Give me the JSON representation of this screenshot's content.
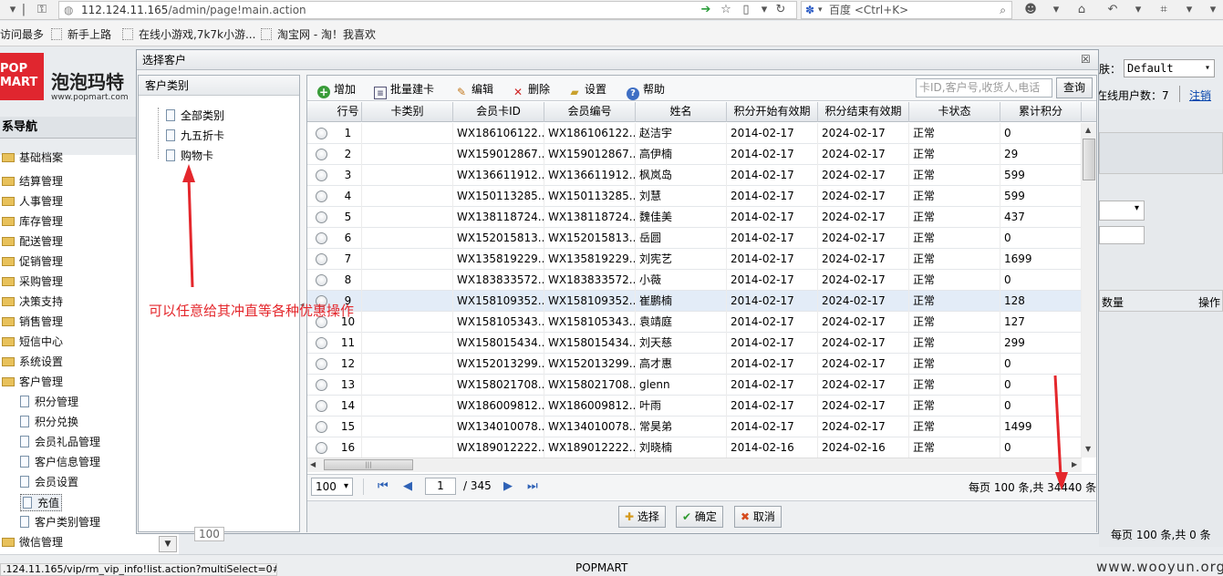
{
  "browser": {
    "url_host": "112.124.11.165",
    "url_path": "/admin/page!main.action",
    "search_engine": "百度",
    "search_placeholder": "<Ctrl+K>",
    "bookmarks": [
      "访问最多",
      "新手上路",
      "在线小游戏,7k7k小游...",
      "淘宝网 - 淘！我喜欢"
    ]
  },
  "app": {
    "logo_line1": "POP",
    "logo_line2": "MART",
    "name": "泡泡玛特",
    "site": "www.popmart.com",
    "theme_label": "肤：",
    "theme_value": "Default",
    "online_label": "在线用户数：7",
    "logout": "注销"
  },
  "sidebar": {
    "title": "系导航",
    "items": [
      {
        "label": "基础档案",
        "type": "folder"
      },
      {
        "label": "结算管理",
        "type": "folder"
      },
      {
        "label": "人事管理",
        "type": "folder"
      },
      {
        "label": "库存管理",
        "type": "folder"
      },
      {
        "label": "配送管理",
        "type": "folder"
      },
      {
        "label": "促销管理",
        "type": "folder"
      },
      {
        "label": "采购管理",
        "type": "folder"
      },
      {
        "label": "决策支持",
        "type": "folder"
      },
      {
        "label": "销售管理",
        "type": "folder"
      },
      {
        "label": "短信中心",
        "type": "folder"
      },
      {
        "label": "系统设置",
        "type": "folder"
      },
      {
        "label": "客户管理",
        "type": "folder-open"
      },
      {
        "label": "积分管理",
        "type": "doc"
      },
      {
        "label": "积分兑换",
        "type": "doc"
      },
      {
        "label": "会员礼品管理",
        "type": "doc"
      },
      {
        "label": "客户信息管理",
        "type": "doc"
      },
      {
        "label": "会员设置",
        "type": "doc"
      },
      {
        "label": "充值",
        "type": "doc"
      },
      {
        "label": "客户类别管理",
        "type": "doc"
      },
      {
        "label": "微信管理",
        "type": "folder"
      }
    ]
  },
  "background": {
    "qty_header": "数量",
    "op_header": "操作",
    "pager_text": "每页 100 条,共 0 条",
    "behind_pager": "100"
  },
  "dialog": {
    "title": "选择客户",
    "close": "☒",
    "category_header": "客户类别",
    "categories": [
      "全部类别",
      "九五折卡",
      "购物卡"
    ],
    "toolbar": {
      "add": "增加",
      "batch": "批量建卡",
      "edit": "编辑",
      "delete": "删除",
      "settings": "设置",
      "help": "帮助",
      "search_placeholder": "卡ID,客户号,收货人,电话",
      "search_btn": "查询"
    },
    "columns": [
      "行号",
      "卡类别",
      "会员卡ID",
      "会员编号",
      "姓名",
      "积分开始有效期",
      "积分结束有效期",
      "卡状态",
      "累计积分"
    ],
    "rows": [
      [
        "1",
        "",
        "WX186106122...",
        "WX186106122...",
        "赵洁宇",
        "2014-02-17",
        "2024-02-17",
        "正常",
        "0"
      ],
      [
        "2",
        "",
        "WX159012867...",
        "WX159012867...",
        "高伊楠",
        "2014-02-17",
        "2024-02-17",
        "正常",
        "29"
      ],
      [
        "3",
        "",
        "WX136611912...",
        "WX136611912...",
        "枫岚岛",
        "2014-02-17",
        "2024-02-17",
        "正常",
        "599"
      ],
      [
        "4",
        "",
        "WX150113285...",
        "WX150113285...",
        "刘慧",
        "2014-02-17",
        "2024-02-17",
        "正常",
        "599"
      ],
      [
        "5",
        "",
        "WX138118724...",
        "WX138118724...",
        "魏佳美",
        "2014-02-17",
        "2024-02-17",
        "正常",
        "437"
      ],
      [
        "6",
        "",
        "WX152015813...",
        "WX152015813...",
        "岳圆",
        "2014-02-17",
        "2024-02-17",
        "正常",
        "0"
      ],
      [
        "7",
        "",
        "WX135819229...",
        "WX135819229...",
        "刘宪艺",
        "2014-02-17",
        "2024-02-17",
        "正常",
        "1699"
      ],
      [
        "8",
        "",
        "WX183833572...",
        "WX183833572...",
        "小薇",
        "2014-02-17",
        "2024-02-17",
        "正常",
        "0"
      ],
      [
        "9",
        "",
        "WX158109352...",
        "WX158109352...",
        "崔鹏楠",
        "2014-02-17",
        "2024-02-17",
        "正常",
        "128"
      ],
      [
        "10",
        "",
        "WX158105343...",
        "WX158105343...",
        "袁靖庭",
        "2014-02-17",
        "2024-02-17",
        "正常",
        "127"
      ],
      [
        "11",
        "",
        "WX158015434...",
        "WX158015434...",
        "刘天慈",
        "2014-02-17",
        "2024-02-17",
        "正常",
        "299"
      ],
      [
        "12",
        "",
        "WX152013299...",
        "WX152013299...",
        "高才惠",
        "2014-02-17",
        "2024-02-17",
        "正常",
        "0"
      ],
      [
        "13",
        "",
        "WX158021708...",
        "WX158021708...",
        "glenn",
        "2014-02-17",
        "2024-02-17",
        "正常",
        "0"
      ],
      [
        "14",
        "",
        "WX186009812...",
        "WX186009812...",
        "叶雨",
        "2014-02-17",
        "2024-02-17",
        "正常",
        "0"
      ],
      [
        "15",
        "",
        "WX134010078...",
        "WX134010078...",
        "常昊弟",
        "2014-02-17",
        "2024-02-17",
        "正常",
        "1499"
      ],
      [
        "16",
        "",
        "WX189012222...",
        "WX189012222...",
        "刘晓楠",
        "2014-02-16",
        "2024-02-16",
        "正常",
        "0"
      ]
    ],
    "highlighted_row": 9,
    "pager": {
      "page_size": "100",
      "current_page": "1",
      "total_pages": "/ 345",
      "info": "每页 100 条,共 34440 条"
    },
    "buttons": {
      "select": "选择",
      "confirm": "确定",
      "cancel": "取消"
    }
  },
  "annotation": "可以任意给其冲直等各种优惠操作",
  "annotation_color": "#e4272c",
  "status": {
    "url": ".124.11.165/vip/rm_vip_info!list.action?multiSelect=0#",
    "brand": "POPMART",
    "watermark": "www.wooyun.org"
  }
}
